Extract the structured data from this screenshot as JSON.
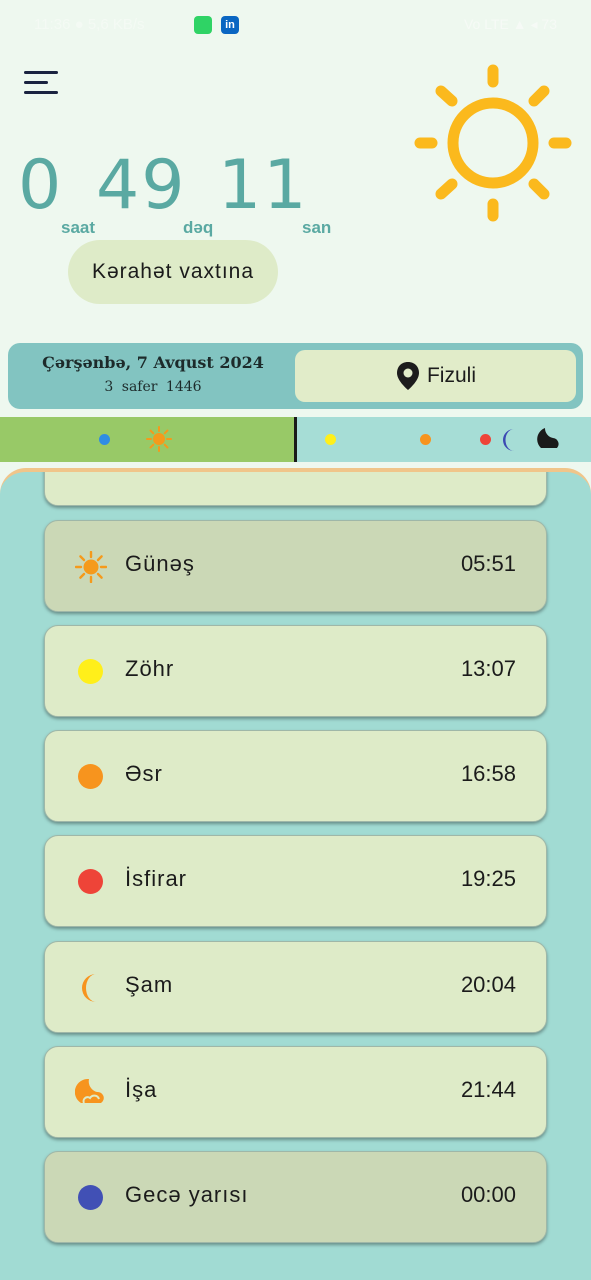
{
  "status_bar": {
    "time": "11:36 ● 5,6 KB/s",
    "right": "Vo LTE ▲ ◂ 73"
  },
  "countdown": {
    "hours": "0",
    "hours_unit": "saat",
    "minutes": "49",
    "minutes_unit": "dəq",
    "seconds": "11",
    "seconds_unit": "san"
  },
  "karahet_label": "Kərahət vaxtına",
  "date": {
    "gregorian": "Çərşənbə, 7 Avqust 2024",
    "hijri": "3 safer 1446"
  },
  "city": "Fizuli",
  "prayers": [
    {
      "name": "Günəş",
      "time": "05:51",
      "icon": "sun-icon",
      "color": "#f59a1b",
      "active": true
    },
    {
      "name": "Zöhr",
      "time": "13:07",
      "icon": "circle-icon",
      "color": "#ffef1a",
      "active": false
    },
    {
      "name": "Əsr",
      "time": "16:58",
      "icon": "circle-icon",
      "color": "#f7941e",
      "active": false
    },
    {
      "name": "İsfirar",
      "time": "19:25",
      "icon": "circle-icon",
      "color": "#ee4438",
      "active": false
    },
    {
      "name": "Şam",
      "time": "20:04",
      "icon": "crescent-icon",
      "color": "#f7941e",
      "active": false
    },
    {
      "name": "İşa",
      "time": "21:44",
      "icon": "moon-cloud-icon",
      "color": "#f7941e",
      "active": false
    },
    {
      "name": "Gecə yarısı",
      "time": "00:00",
      "icon": "circle-icon",
      "color": "#4150b5",
      "active": true
    }
  ],
  "colors": {
    "accent": "#5aa9a2",
    "sun": "#fbb91d",
    "timeline_past": "#98c967",
    "timeline_future": "#a6ddd6",
    "panel": "#a1dbd3",
    "card": "#deebc8"
  }
}
